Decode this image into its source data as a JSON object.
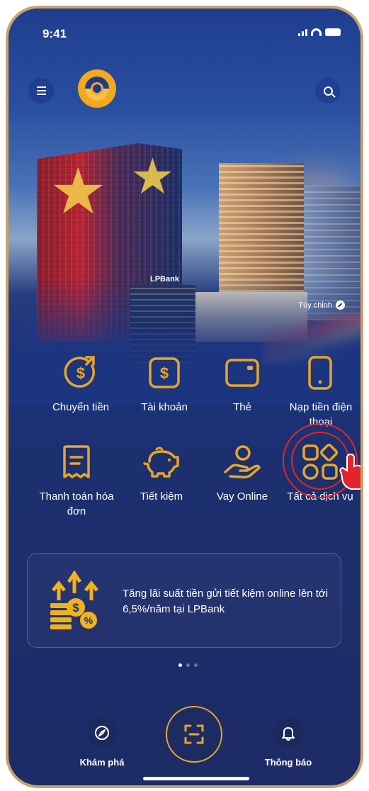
{
  "status_bar": {
    "time": "9:41"
  },
  "hero": {
    "customize_label": "Tùy chỉnh",
    "building_sign": "LPBank"
  },
  "quick_actions": [
    {
      "label": "Chuyển tiền",
      "icon": "transfer-dollar-icon"
    },
    {
      "label": "Tài khoản",
      "icon": "account-dollar-icon"
    },
    {
      "label": "Thẻ",
      "icon": "card-icon"
    },
    {
      "label": "Nạp tiền điện thoại",
      "icon": "phone-topup-icon"
    },
    {
      "label": "Thanh toán hóa đơn",
      "icon": "bill-icon"
    },
    {
      "label": "Tiết kiệm",
      "icon": "piggy-bank-icon"
    },
    {
      "label": "Vay Online",
      "icon": "loan-hand-icon"
    },
    {
      "label": "Tất cả dịch vụ",
      "icon": "all-services-icon"
    }
  ],
  "promo": {
    "text": "Tăng lãi suất tiền gửi tiết kiệm online lên tới 6,5%/năm tại LPBank"
  },
  "carousel": {
    "total": 3,
    "active": 1
  },
  "bottom_nav": {
    "explore_label": "Khám phá",
    "notifications_label": "Thông báo"
  },
  "colors": {
    "accent": "#e8a626",
    "background": "#1c3581",
    "highlight": "#e1252a"
  }
}
